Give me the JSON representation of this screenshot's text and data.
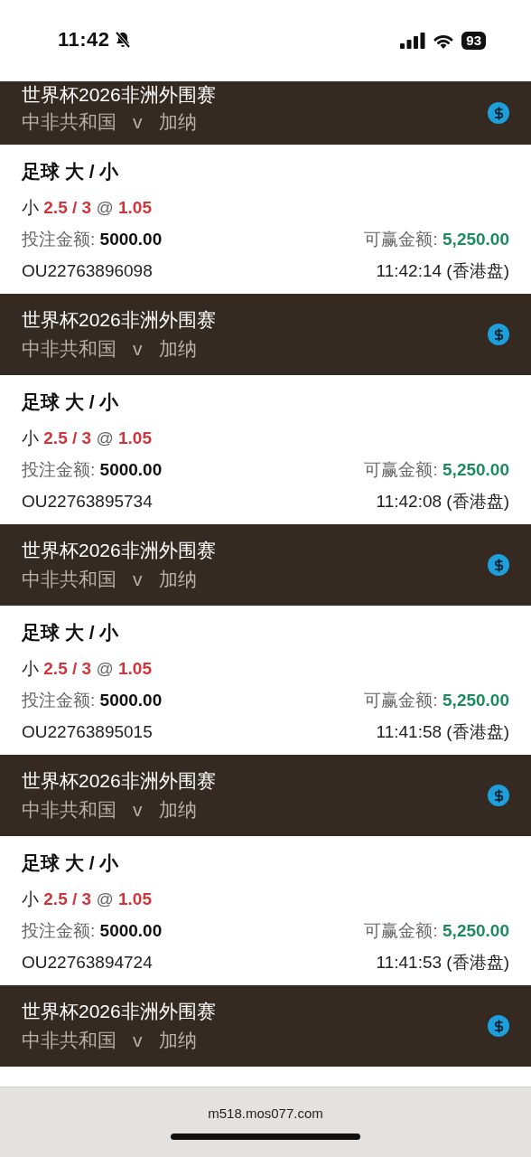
{
  "status_bar": {
    "time": "11:42",
    "battery": "93"
  },
  "slips": [
    {
      "league": "世界杯2026非洲外围赛",
      "home": "中非共和国",
      "vs": "v",
      "away": "加纳",
      "clipped": true,
      "bet": {
        "market": "足球 大 / 小",
        "side": "小",
        "line": "2.5 / 3",
        "at": "@",
        "odds": "1.05",
        "stake_label": "投注金额:",
        "stake": "5000.00",
        "win_label": "可赢金额:",
        "win": "5,250.00",
        "ticket": "OU22763896098",
        "time": "11:42:14 (香港盘)"
      }
    },
    {
      "league": "世界杯2026非洲外围赛",
      "home": "中非共和国",
      "vs": "v",
      "away": "加纳",
      "clipped": false,
      "bet": {
        "market": "足球 大 / 小",
        "side": "小",
        "line": "2.5 / 3",
        "at": "@",
        "odds": "1.05",
        "stake_label": "投注金额:",
        "stake": "5000.00",
        "win_label": "可赢金额:",
        "win": "5,250.00",
        "ticket": "OU22763895734",
        "time": "11:42:08 (香港盘)"
      }
    },
    {
      "league": "世界杯2026非洲外围赛",
      "home": "中非共和国",
      "vs": "v",
      "away": "加纳",
      "clipped": false,
      "bet": {
        "market": "足球 大 / 小",
        "side": "小",
        "line": "2.5 / 3",
        "at": "@",
        "odds": "1.05",
        "stake_label": "投注金额:",
        "stake": "5000.00",
        "win_label": "可赢金额:",
        "win": "5,250.00",
        "ticket": "OU22763895015",
        "time": "11:41:58 (香港盘)"
      }
    },
    {
      "league": "世界杯2026非洲外围赛",
      "home": "中非共和国",
      "vs": "v",
      "away": "加纳",
      "clipped": false,
      "bet": {
        "market": "足球 大 / 小",
        "side": "小",
        "line": "2.5 / 3",
        "at": "@",
        "odds": "1.05",
        "stake_label": "投注金额:",
        "stake": "5000.00",
        "win_label": "可赢金额:",
        "win": "5,250.00",
        "ticket": "OU22763894724",
        "time": "11:41:53 (香港盘)"
      }
    },
    {
      "league": "世界杯2026非洲外围赛",
      "home": "中非共和国",
      "vs": "v",
      "away": "加纳",
      "clipped": false
    }
  ],
  "address_bar": {
    "url": "m518.mos077.com"
  }
}
